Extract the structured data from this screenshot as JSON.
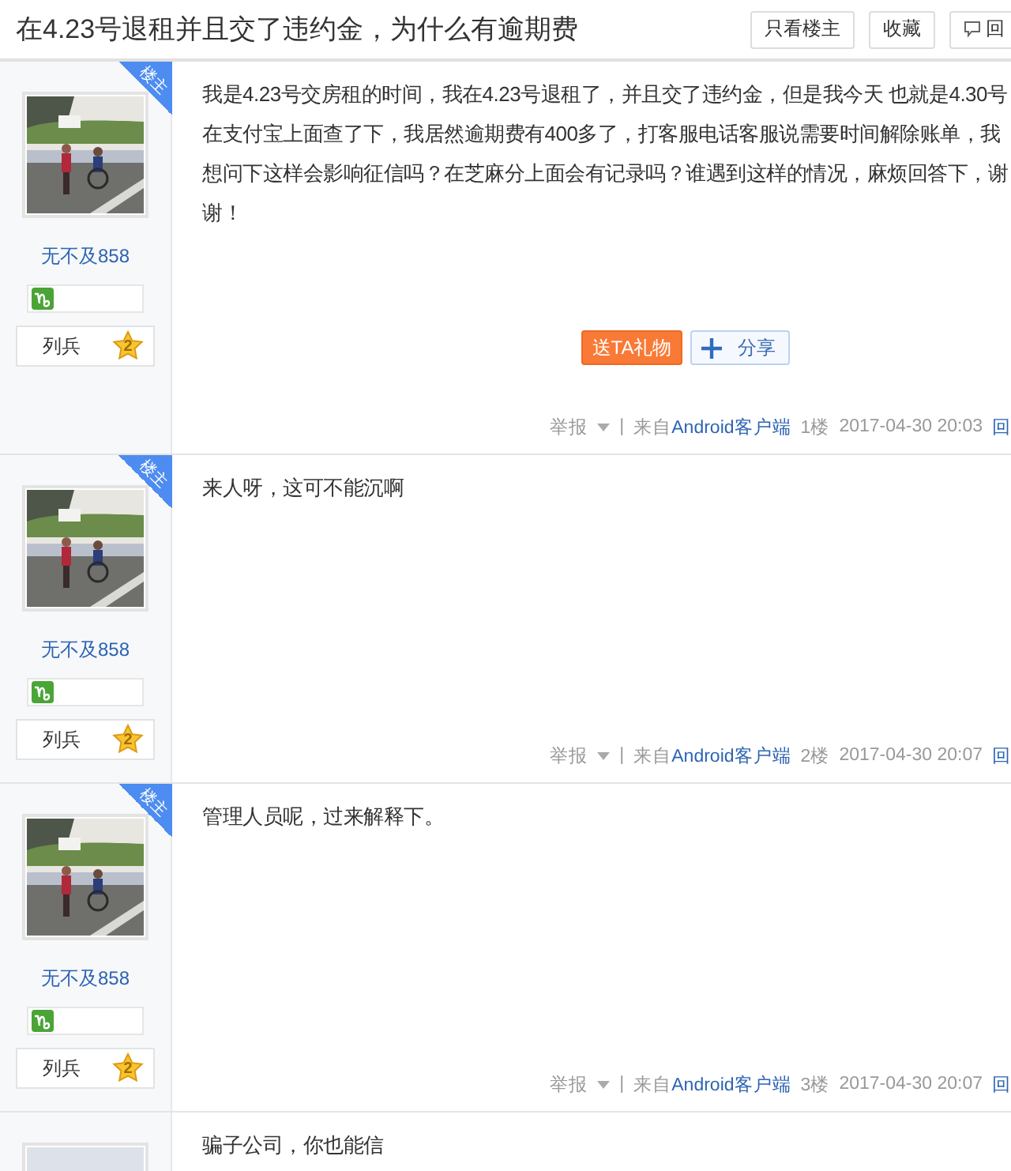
{
  "title": "在4.23号退租并且交了违约金，为什么有逾期费",
  "header_buttons": [
    {
      "label": "只看楼主",
      "kind": "text"
    },
    {
      "label": "收藏",
      "kind": "text"
    },
    {
      "label": "回",
      "kind": "reply"
    }
  ],
  "posts": [
    {
      "author": {
        "op_badge": "楼主",
        "name": "无不及858",
        "rank": "列兵",
        "level": "2"
      },
      "content": "我是4.23号交房租的时间，我在4.23号退租了，并且交了违约金，但是我今天 也就是4.30号在支付宝上面查了下，我居然逾期费有400多了，打客服电话客服说需要时间解除账单，我想问下这样会影响征信吗？在芝麻分上面会有记录吗？谁遇到这样的情况，麻烦回答下，谢谢！",
      "actions": {
        "gift": "送TA礼物",
        "share": "分享"
      },
      "footer": {
        "report": "举报",
        "separator": "|",
        "source_prefix": "来自",
        "source": "Android客户端",
        "floor": "1楼",
        "time": "2017-04-30 20:03",
        "reply": "回"
      }
    },
    {
      "author": {
        "op_badge": "楼主",
        "name": "无不及858",
        "rank": "列兵",
        "level": "2"
      },
      "content": "来人呀，这可不能沉啊",
      "footer": {
        "report": "举报",
        "separator": "|",
        "source_prefix": "来自",
        "source": "Android客户端",
        "floor": "2楼",
        "time": "2017-04-30 20:07",
        "reply": "回"
      }
    },
    {
      "author": {
        "op_badge": "楼主",
        "name": "无不及858",
        "rank": "列兵",
        "level": "2"
      },
      "content": "管理人员呢，过来解释下。",
      "footer": {
        "report": "举报",
        "separator": "|",
        "source_prefix": "来自",
        "source": "Android客户端",
        "floor": "3楼",
        "time": "2017-04-30 20:07",
        "reply": "回"
      }
    },
    {
      "author": {
        "avatar": {
          "kind": "default"
        }
      },
      "content": "骗子公司，你也能信"
    }
  ]
}
